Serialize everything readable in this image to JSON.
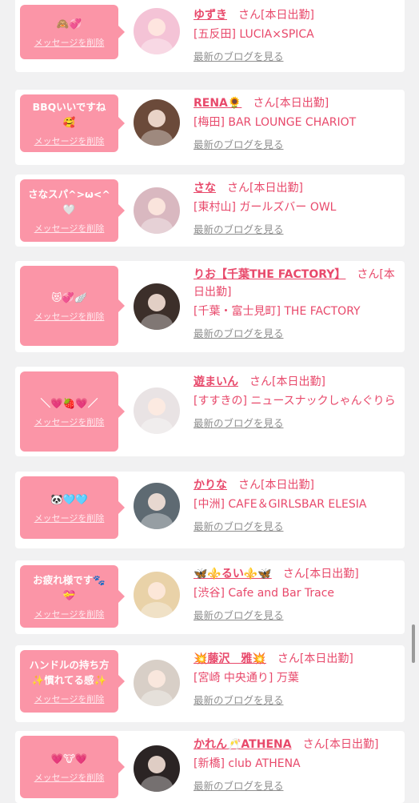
{
  "delete_label": "メッセージを削除",
  "blog_label": "最新のブログを見る",
  "accent_color": "#e8496b",
  "bubble_color": "#fb95a7",
  "items": [
    {
      "message": "🙈💞",
      "name": "ゆずき",
      "suffix": "さん[本日出勤]",
      "shop": "[五反田] LUCIA×SPICA",
      "avatar": "anime-avatar"
    },
    {
      "message": "BBQいいですね\n🥰",
      "name": "RENA🌻",
      "suffix": "さん[本日出勤]",
      "shop": "[梅田] BAR LOUNGE CHARIOT",
      "avatar": "photo-avatar"
    },
    {
      "message": "さなスパ^>ω<^\n🤍",
      "name": "さな",
      "suffix": "さん[本日出勤]",
      "shop": "[東村山] ガールズバー OWL",
      "avatar": "mustache-avatar"
    },
    {
      "message": "😻💞🪽",
      "name": "りお【千葉THE FACTORY】",
      "suffix": "さん[本日出勤]",
      "shop": "[千葉・富士見町] THE FACTORY",
      "avatar": "photo-avatar"
    },
    {
      "message": "＼💗🍓💗／",
      "name": "遊まいん",
      "suffix": "さん[本日出勤]",
      "shop": "[すすきの] ニュースナックしゃんぐりら",
      "avatar": "photo-avatar"
    },
    {
      "message": "🐼🩵🩵",
      "name": "かりな",
      "suffix": "さん[本日出勤]",
      "shop": "[中洲] CAFE＆GIRLSBAR ELESIA",
      "avatar": "photo-avatar"
    },
    {
      "message": "お疲れ様です🐾\n💝",
      "name": "🦋⚜️るい⚜️🦋",
      "suffix": "さん[本日出勤]",
      "shop": "[渋谷] Cafe and Bar Trace",
      "avatar": "photo-avatar"
    },
    {
      "message": "ハンドルの持ち方\n✨慣れてる感✨",
      "name": "💥藤沢　雅💥",
      "suffix": "さん[本日出勤]",
      "shop": "[宮崎 中央通り] 万葉",
      "avatar": "photo-avatar"
    },
    {
      "message": "💗🐮💗",
      "name": "かれん🥂ATHENA",
      "suffix": "さん[本日出勤]",
      "shop": "[新橋] club ATHENA",
      "avatar": "photo-avatar"
    }
  ]
}
